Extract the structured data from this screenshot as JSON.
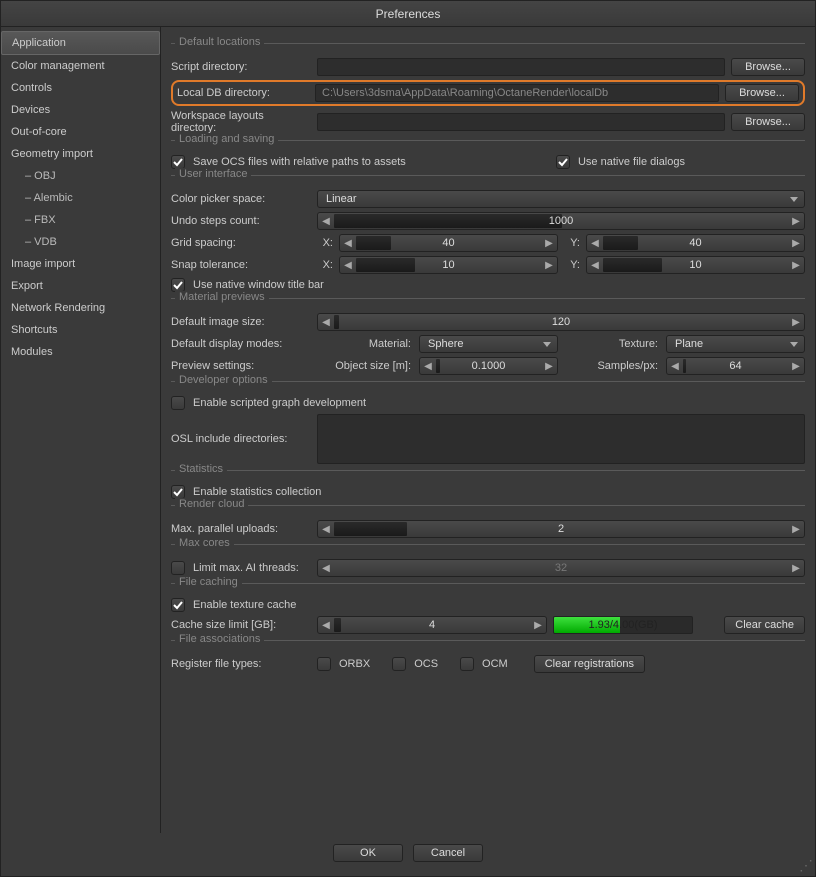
{
  "title": "Preferences",
  "sidebar": {
    "items": [
      {
        "label": "Application",
        "selected": true
      },
      {
        "label": "Color management"
      },
      {
        "label": "Controls"
      },
      {
        "label": "Devices"
      },
      {
        "label": "Out-of-core"
      },
      {
        "label": "Geometry import"
      },
      {
        "label": "–  OBJ",
        "sub": true
      },
      {
        "label": "–  Alembic",
        "sub": true
      },
      {
        "label": "–  FBX",
        "sub": true
      },
      {
        "label": "–  VDB",
        "sub": true
      },
      {
        "label": "Image import"
      },
      {
        "label": "Export"
      },
      {
        "label": "Network Rendering"
      },
      {
        "label": "Shortcuts"
      },
      {
        "label": "Modules"
      }
    ]
  },
  "sections": {
    "defaultLocations": "Default locations",
    "loadingSaving": "Loading and saving",
    "userInterface": "User interface",
    "materialPreviews": "Material previews",
    "developerOptions": "Developer options",
    "statistics": "Statistics",
    "renderCloud": "Render cloud",
    "maxCores": "Max cores",
    "fileCaching": "File caching",
    "fileAssociations": "File associations"
  },
  "labels": {
    "scriptDir": "Script directory:",
    "localDb": "Local DB directory:",
    "localDbValue": "C:\\Users\\3dsma\\AppData\\Roaming\\OctaneRender\\localDb",
    "workspaceLayouts": "Workspace layouts directory:",
    "browse": "Browse...",
    "saveOcs": "Save OCS files with relative paths to assets",
    "nativeDialogs": "Use native file dialogs",
    "colorPicker": "Color picker space:",
    "linear": "Linear",
    "undoSteps": "Undo steps count:",
    "undoVal": "1000",
    "gridSpacing": "Grid spacing:",
    "snapTol": "Snap tolerance:",
    "xLabel": "X:",
    "yLabel": "Y:",
    "gridX": "40",
    "gridY": "40",
    "snapX": "10",
    "snapY": "10",
    "nativeTitle": "Use native window title bar",
    "defaultImgSize": "Default image size:",
    "imgSizeVal": "120",
    "displayModes": "Default display modes:",
    "materialLbl": "Material:",
    "textureLbl": "Texture:",
    "sphere": "Sphere",
    "plane": "Plane",
    "previewSettings": "Preview settings:",
    "objSize": "Object size [m]:",
    "objSizeVal": "0.1000",
    "samplesPx": "Samples/px:",
    "samplesVal": "64",
    "scriptedGraph": "Enable scripted graph development",
    "oslInclude": "OSL include directories:",
    "statsCollection": "Enable statistics collection",
    "maxUploads": "Max. parallel uploads:",
    "uploadsVal": "2",
    "limitAI": "Limit max. AI threads:",
    "aiVal": "32",
    "textureCache": "Enable texture cache",
    "cacheSize": "Cache size limit [GB]:",
    "cacheSizeVal": "4",
    "cacheUsage": "1.93/4.00(GB)",
    "clearCache": "Clear cache",
    "registerTypes": "Register file types:",
    "orbx": "ORBX",
    "ocs": "OCS",
    "ocm": "OCM",
    "clearReg": "Clear registrations",
    "ok": "OK",
    "cancel": "Cancel"
  }
}
